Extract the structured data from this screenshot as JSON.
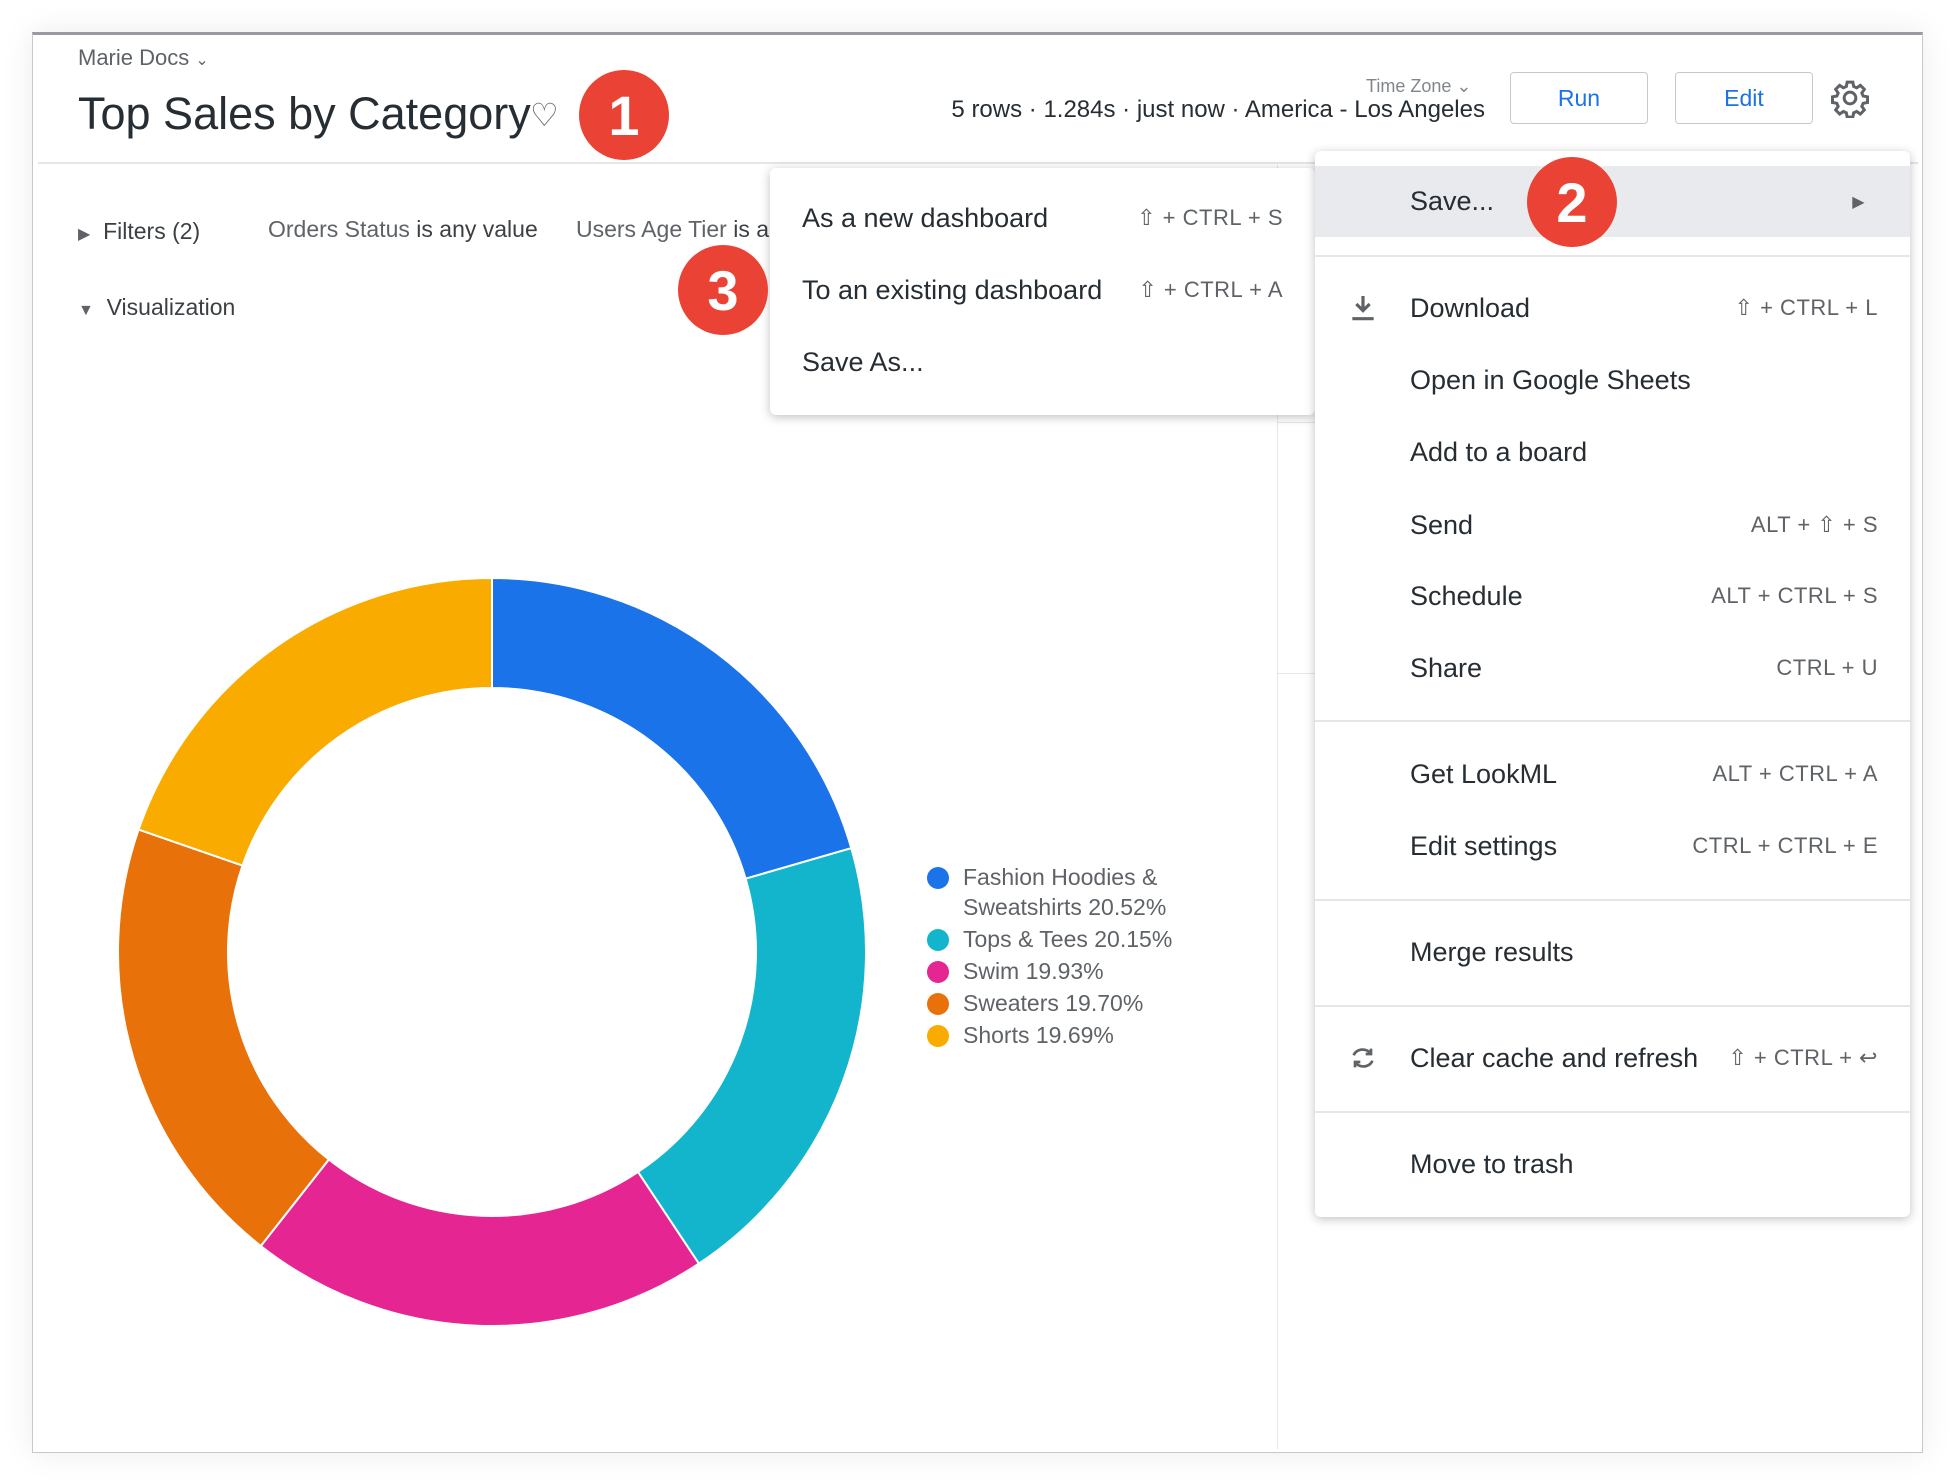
{
  "header": {
    "breadcrumb": "Marie Docs",
    "title": "Top Sales by Category",
    "timezone_label": "Time Zone",
    "stats": "5 rows · 1.284s · just now · America - Los Angeles",
    "run_label": "Run",
    "edit_label": "Edit"
  },
  "filters": {
    "toggle_label": "Filters (2)",
    "items": [
      {
        "field": "Orders Status",
        "op": "is any value"
      },
      {
        "field": "Users Age Tier",
        "op": "is a"
      }
    ]
  },
  "visualization": {
    "label": "Visualization"
  },
  "badges": [
    "1",
    "2",
    "3"
  ],
  "menu": {
    "items": [
      {
        "label": "Save...",
        "shortcut": "",
        "highlighted": true,
        "submenu": true
      },
      {
        "label": "Download",
        "shortcut": "⇧ + CTRL + L",
        "icon": "download-icon"
      },
      {
        "label": "Open in Google Sheets",
        "shortcut": ""
      },
      {
        "label": "Add to a board",
        "shortcut": ""
      },
      {
        "label": "Send",
        "shortcut": "ALT + ⇧ + S"
      },
      {
        "label": "Schedule",
        "shortcut": "ALT + CTRL + S"
      },
      {
        "label": "Share",
        "shortcut": "CTRL + U"
      },
      {
        "label": "Get LookML",
        "shortcut": "ALT + CTRL + A"
      },
      {
        "label": "Edit settings",
        "shortcut": "CTRL + CTRL + E"
      },
      {
        "label": "Merge results",
        "shortcut": ""
      },
      {
        "label": "Clear cache and refresh",
        "shortcut": "⇧ + CTRL + ↩",
        "icon": "refresh-icon"
      },
      {
        "label": "Move to trash",
        "shortcut": ""
      }
    ]
  },
  "save_submenu": {
    "items": [
      {
        "label": "As a new dashboard",
        "shortcut": "⇧ + CTRL + S"
      },
      {
        "label": "To an existing dashboard",
        "shortcut": "⇧ + CTRL + A"
      },
      {
        "label": "Save As...",
        "shortcut": ""
      }
    ]
  },
  "colors": {
    "badge": "#ea4335",
    "accent": "#1a73e8"
  },
  "chart_data": {
    "type": "pie",
    "donut": true,
    "legend_position": "right",
    "categories": [
      "Fashion Hoodies & Sweatshirts",
      "Tops & Tees",
      "Swim",
      "Sweaters",
      "Shorts"
    ],
    "values": [
      20.52,
      20.15,
      19.93,
      19.7,
      19.69
    ],
    "legend_labels": [
      "Fashion Hoodies &",
      "Sweatshirts 20.52%",
      "Tops & Tees 20.15%",
      "Swim 19.93%",
      "Sweaters 19.70%",
      "Shorts 19.69%"
    ],
    "colors": [
      "#1a73e8",
      "#12b5cb",
      "#e52592",
      "#e8710a",
      "#f9ab00"
    ]
  }
}
